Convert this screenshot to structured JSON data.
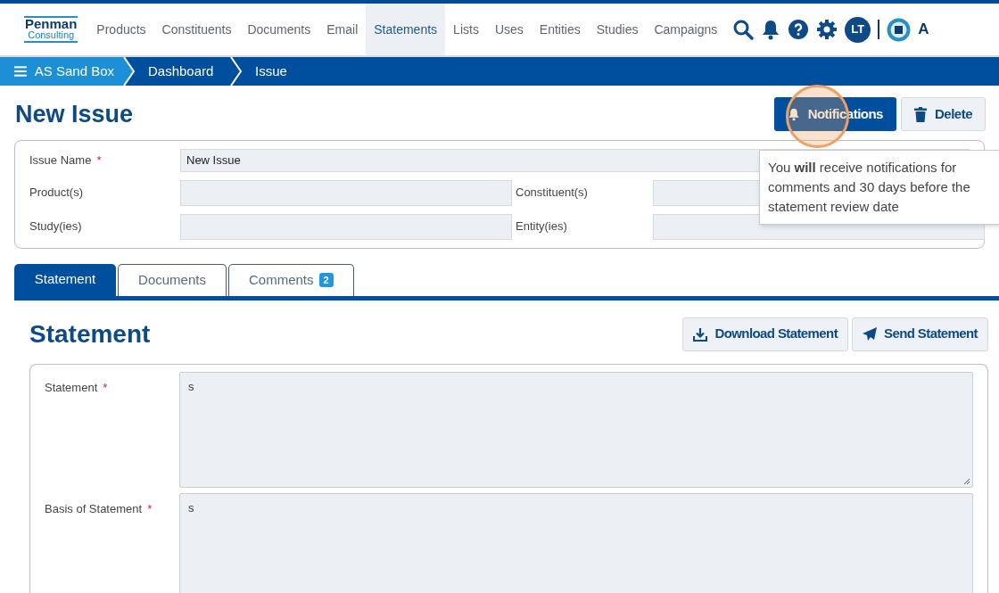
{
  "header": {
    "logo": {
      "line1": "Penman",
      "line2": "Consulting"
    },
    "nav": [
      {
        "label": "Products",
        "selected": false
      },
      {
        "label": "Constituents",
        "selected": false
      },
      {
        "label": "Documents",
        "selected": false
      },
      {
        "label": "Email",
        "selected": false
      },
      {
        "label": "Statements",
        "selected": true
      },
      {
        "label": "Lists",
        "selected": false
      },
      {
        "label": "Uses",
        "selected": false
      },
      {
        "label": "Entities",
        "selected": false
      },
      {
        "label": "Studies",
        "selected": false
      },
      {
        "label": "Campaigns",
        "selected": false
      }
    ],
    "avatar": "LT",
    "account_label": "A"
  },
  "breadcrumb": [
    {
      "label": "AS Sand Box"
    },
    {
      "label": "Dashboard"
    },
    {
      "label": "Issue"
    }
  ],
  "page_title": "New Issue",
  "actions": [
    {
      "kind": "primary",
      "label": "Notifications"
    },
    {
      "kind": "secondary",
      "label": "Delete"
    }
  ],
  "tooltip": "You **will** receive notifications for comments and 30 days before the statement review date",
  "issue_form": {
    "name": {
      "label": "Issue Name",
      "required_mark": "*",
      "value": "New Issue"
    },
    "fields": [
      {
        "label": "Product(s)"
      },
      {
        "label": "Constituent(s)"
      },
      {
        "label": "Study(ies)"
      },
      {
        "label": "Entity(ies)"
      }
    ]
  },
  "tabs": [
    {
      "label": "Statement",
      "selected": true
    },
    {
      "label": "Documents",
      "selected": false
    },
    {
      "label": "Comments",
      "selected": false,
      "badge": "2"
    }
  ],
  "section": {
    "title": "Statement",
    "buttons": [
      {
        "kind": "download",
        "label": "Download Statement"
      },
      {
        "kind": "send",
        "label": "Send Statement"
      }
    ],
    "fields": [
      {
        "label": "Statement",
        "required_mark": "*",
        "value": "s",
        "resizable": true
      },
      {
        "label": "Basis of Statement",
        "required_mark": "*",
        "value": "s"
      }
    ]
  }
}
